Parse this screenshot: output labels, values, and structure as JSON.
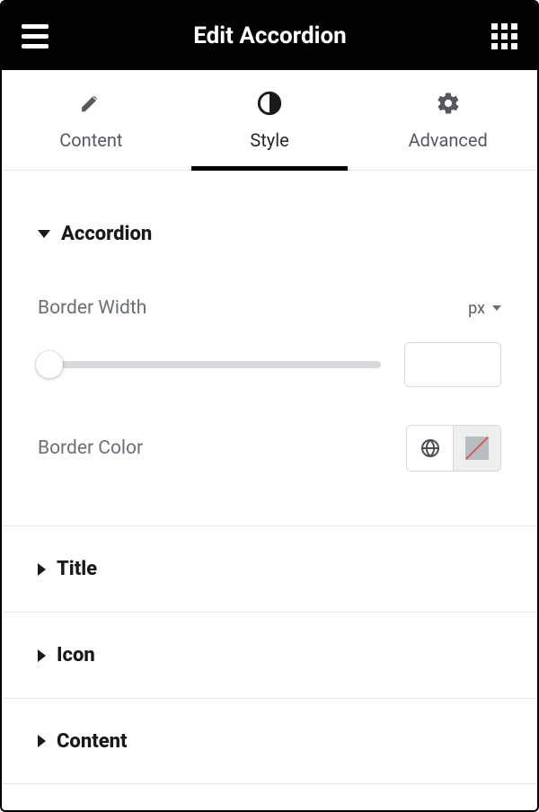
{
  "header": {
    "title": "Edit Accordion"
  },
  "tabs": [
    {
      "id": "content",
      "label": "Content",
      "active": false
    },
    {
      "id": "style",
      "label": "Style",
      "active": true
    },
    {
      "id": "advanced",
      "label": "Advanced",
      "active": false
    }
  ],
  "sections": {
    "accordion": {
      "title": "Accordion",
      "expanded": true,
      "controls": {
        "borderWidth": {
          "label": "Border Width",
          "unit": "px",
          "value": "",
          "sliderPos": 0
        },
        "borderColor": {
          "label": "Border Color",
          "value": null,
          "globalIcon": "globe-icon"
        }
      }
    },
    "title": {
      "title": "Title",
      "expanded": false
    },
    "icon": {
      "title": "Icon",
      "expanded": false
    },
    "content": {
      "title": "Content",
      "expanded": false
    }
  }
}
